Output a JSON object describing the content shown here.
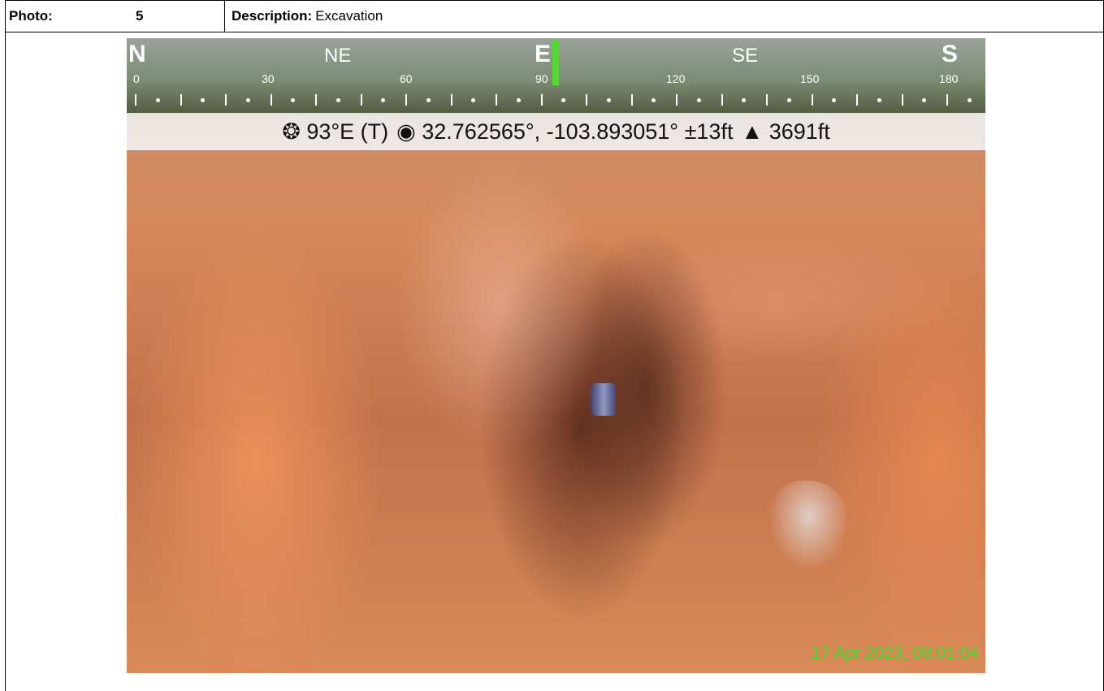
{
  "header": {
    "photo_label": "Photo:",
    "photo_number": "5",
    "description_label": "Description:",
    "description_value": "Excavation"
  },
  "compass": {
    "directions": [
      "N",
      "NE",
      "E",
      "SE",
      "S"
    ],
    "degree_labels": [
      "0",
      "30",
      "60",
      "90",
      "120",
      "150",
      "180"
    ],
    "accent_color": "#4ddb2c"
  },
  "info_bar": {
    "heading": "93°E (T)",
    "coordinates": "32.762565°, -103.893051° ±13ft",
    "elevation": "3691ft",
    "icons": [
      "compass-rose-icon",
      "location-dot-icon",
      "elevation-triangle-icon"
    ]
  },
  "timestamp": "17 Apr 2023, 08:01:04"
}
